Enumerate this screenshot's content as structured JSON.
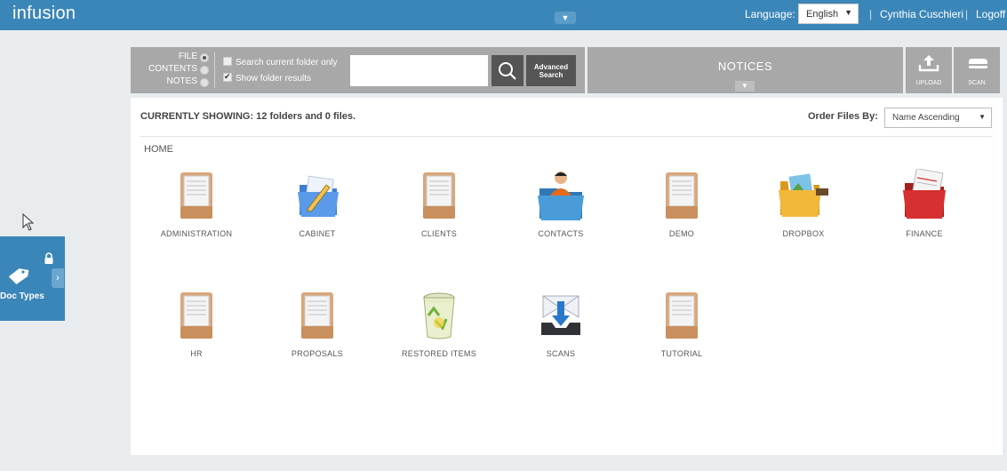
{
  "header": {
    "logo": "infusion",
    "language_label": "Language:",
    "language_value": "English",
    "separator": "|",
    "user_name": "Cynthia Cuschieri",
    "logoff": "Logoff"
  },
  "sidebar": {
    "doc_types_label": "Doc Types"
  },
  "toolbar": {
    "search_modes": [
      {
        "label": "FILE",
        "selected": true
      },
      {
        "label": "CONTENTS",
        "selected": false
      },
      {
        "label": "NOTES",
        "selected": false
      }
    ],
    "search_current_folder_only": {
      "label": "Search current folder only",
      "checked": false
    },
    "show_folder_results": {
      "label": "Show folder results",
      "checked": true
    },
    "search_value": "",
    "advanced_search_line1": "Advanced",
    "advanced_search_line2": "Search",
    "notices_title": "NOTICES",
    "upload_label": "UPLOAD",
    "scan_label": "SCAN"
  },
  "main": {
    "currently_showing": "CURRENTLY SHOWING: 12 folders and 0 files.",
    "order_label": "Order Files By:",
    "order_value": "Name Ascending",
    "breadcrumb": "HOME",
    "folders": [
      {
        "name": "ADMINISTRATION",
        "icon": "drawer-icon"
      },
      {
        "name": "CABINET",
        "icon": "pencil-folder-icon"
      },
      {
        "name": "CLIENTS",
        "icon": "drawer-icon"
      },
      {
        "name": "CONTACTS",
        "icon": "contacts-folder-icon"
      },
      {
        "name": "DEMO",
        "icon": "drawer-icon"
      },
      {
        "name": "DROPBOX",
        "icon": "photo-folder-icon"
      },
      {
        "name": "FINANCE",
        "icon": "red-folder-icon"
      },
      {
        "name": "HR",
        "icon": "drawer-icon"
      },
      {
        "name": "PROPOSALS",
        "icon": "drawer-icon"
      },
      {
        "name": "RESTORED ITEMS",
        "icon": "recycle-bin-icon"
      },
      {
        "name": "SCANS",
        "icon": "inbox-download-icon"
      },
      {
        "name": "TUTORIAL",
        "icon": "drawer-icon"
      }
    ]
  },
  "colors": {
    "header_blue": "#3b86b8",
    "toolbar_gray": "#a8a8a8",
    "button_dark": "#555555"
  }
}
